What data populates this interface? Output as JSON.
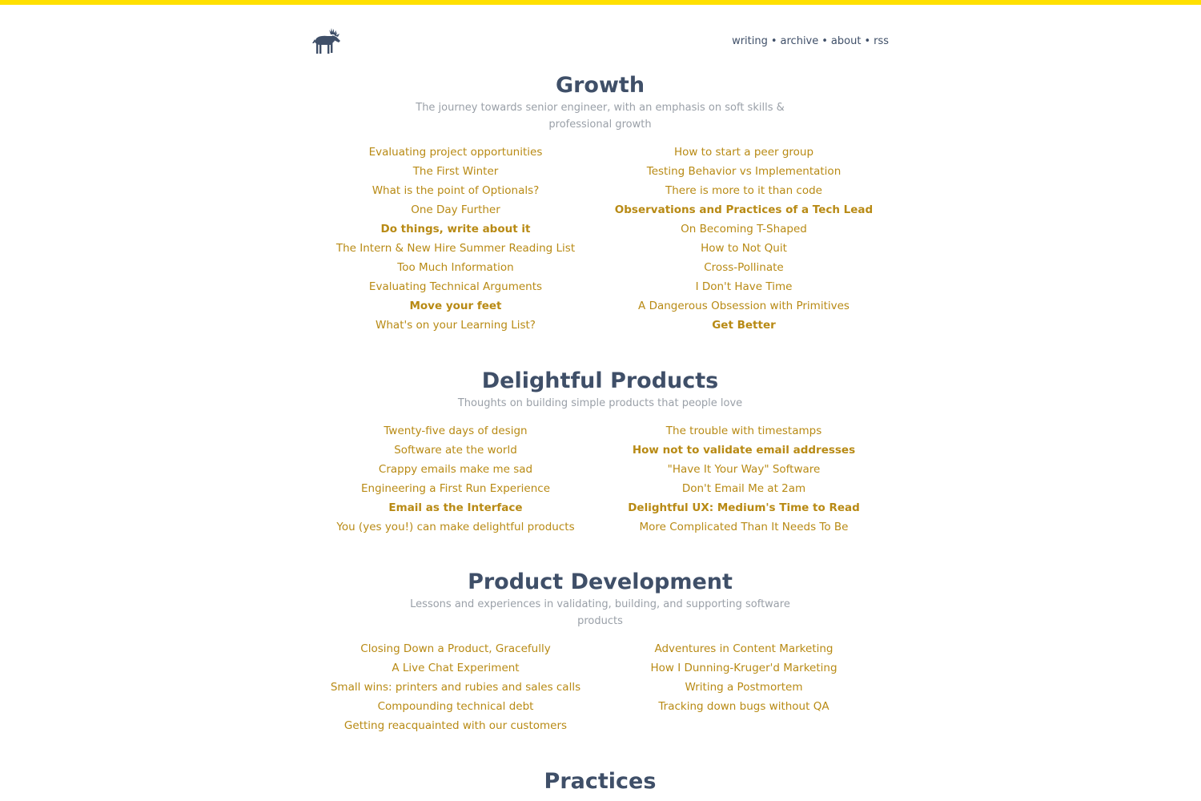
{
  "header": {
    "nav": [
      "writing",
      "archive",
      "about",
      "rss"
    ]
  },
  "colors": {
    "accent_bar": "#FFE000",
    "heading": "#3f4f68",
    "link": "#b88a14",
    "muted": "#9aa0a8"
  },
  "sections": [
    {
      "title": "Growth",
      "description": "The journey towards senior engineer, with an emphasis on soft skills & professional growth",
      "left": [
        {
          "label": "Evaluating project opportunities",
          "bold": false
        },
        {
          "label": "The First Winter",
          "bold": false
        },
        {
          "label": "What is the point of Optionals?",
          "bold": false
        },
        {
          "label": "One Day Further",
          "bold": false
        },
        {
          "label": "Do things, write about it",
          "bold": true
        },
        {
          "label": "The Intern & New Hire Summer Reading List",
          "bold": false
        },
        {
          "label": "Too Much Information",
          "bold": false
        },
        {
          "label": "Evaluating Technical Arguments",
          "bold": false
        },
        {
          "label": "Move your feet",
          "bold": true
        },
        {
          "label": "What's on your Learning List?",
          "bold": false
        }
      ],
      "right": [
        {
          "label": "How to start a peer group",
          "bold": false
        },
        {
          "label": "Testing Behavior vs Implementation",
          "bold": false
        },
        {
          "label": "There is more to it than code",
          "bold": false
        },
        {
          "label": "Observations and Practices of a Tech Lead",
          "bold": true
        },
        {
          "label": "On Becoming T-Shaped",
          "bold": false
        },
        {
          "label": "How to Not Quit",
          "bold": false
        },
        {
          "label": "Cross-Pollinate",
          "bold": false
        },
        {
          "label": "I Don't Have Time",
          "bold": false
        },
        {
          "label": "A Dangerous Obsession with Primitives",
          "bold": false
        },
        {
          "label": "Get Better",
          "bold": true
        }
      ]
    },
    {
      "title": "Delightful Products",
      "description": "Thoughts on building simple products that people love",
      "left": [
        {
          "label": "Twenty-five days of design",
          "bold": false
        },
        {
          "label": "Software ate the world",
          "bold": false
        },
        {
          "label": "Crappy emails make me sad",
          "bold": false
        },
        {
          "label": "Engineering a First Run Experience",
          "bold": false
        },
        {
          "label": "Email as the Interface",
          "bold": true
        },
        {
          "label": "You (yes you!) can make delightful products",
          "bold": false
        }
      ],
      "right": [
        {
          "label": "The trouble with timestamps",
          "bold": false
        },
        {
          "label": "How not to validate email addresses",
          "bold": true
        },
        {
          "label": "\"Have It Your Way\" Software",
          "bold": false
        },
        {
          "label": "Don't Email Me at 2am",
          "bold": false
        },
        {
          "label": "Delightful UX: Medium's Time to Read",
          "bold": true
        },
        {
          "label": "More Complicated Than It Needs To Be",
          "bold": false
        }
      ]
    },
    {
      "title": "Product Development",
      "description": "Lessons and experiences in validating, building, and supporting software products",
      "left": [
        {
          "label": "Closing Down a Product, Gracefully",
          "bold": false
        },
        {
          "label": "A Live Chat Experiment",
          "bold": false
        },
        {
          "label": "Small wins: printers and rubies and sales calls",
          "bold": false
        },
        {
          "label": "Compounding technical debt",
          "bold": false
        },
        {
          "label": "Getting reacquainted with our customers",
          "bold": false
        }
      ],
      "right": [
        {
          "label": "Adventures in Content Marketing",
          "bold": false
        },
        {
          "label": "How I Dunning-Kruger'd Marketing",
          "bold": false
        },
        {
          "label": "Writing a Postmortem",
          "bold": false
        },
        {
          "label": "Tracking down bugs without QA",
          "bold": false
        }
      ]
    },
    {
      "title": "Practices",
      "description": "",
      "left": [],
      "right": []
    }
  ]
}
